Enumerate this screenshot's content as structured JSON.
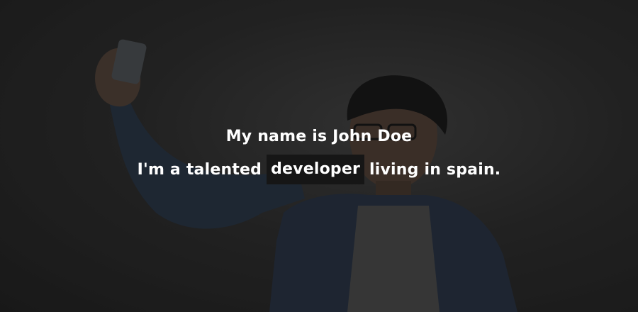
{
  "hero": {
    "headline": "My name is John Doe",
    "tagline_before": "I'm a talented",
    "tagline_highlight": "developer",
    "tagline_after": "living in spain."
  },
  "colors": {
    "text": "#ffffff",
    "highlight_background": "#161616",
    "overlay": "rgba(0,0,0,0.35)"
  },
  "photo": {
    "subject": "selfie-person-icon"
  }
}
